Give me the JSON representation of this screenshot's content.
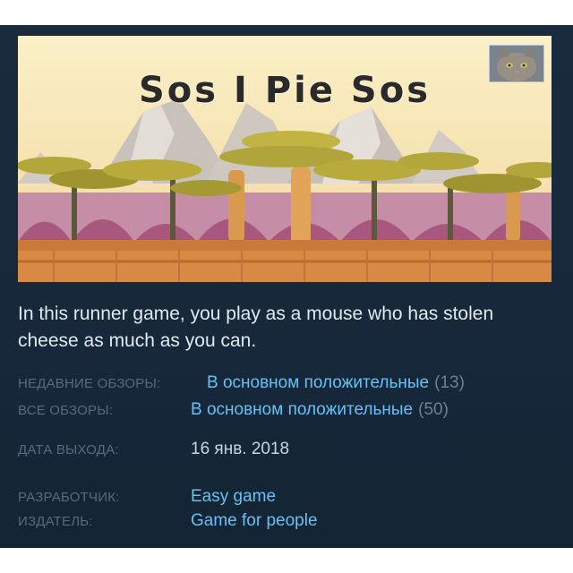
{
  "game": {
    "title": "Sos  I Pie Sos",
    "description": "In this runner game, you play as a mouse who has stolen cheese as much as you can."
  },
  "reviews": {
    "recent_label": "НЕДАВНИЕ ОБЗОРЫ:",
    "recent_value": "В основном положительные",
    "recent_count": "(13)",
    "all_label": "ВСЕ ОБЗОРЫ:",
    "all_value": "В основном положительные",
    "all_count": "(50)"
  },
  "release": {
    "label": "ДАТА ВЫХОДА:",
    "value": "16 янв. 2018"
  },
  "developer": {
    "label": "РАЗРАБОТЧИК:",
    "value": "Easy game"
  },
  "publisher": {
    "label": "ИЗДАТЕЛЬ:",
    "value": "Game for people"
  },
  "colors": {
    "panel_bg": "#1a2b3d",
    "link": "#67c1f5",
    "label": "#566b7e",
    "text": "#e4e9ef"
  },
  "icons": {
    "avatar": "cat-avatar-icon"
  }
}
